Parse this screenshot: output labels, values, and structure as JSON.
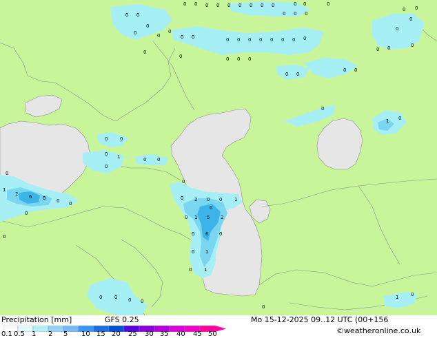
{
  "title": "Precipitation [mm]",
  "model": "GFS 0.25",
  "datetime": "Mo 15-12-2025 09..12 UTC (00+156",
  "credit": "©weatheronline.co.uk",
  "colors": {
    "land": "#c8f59a",
    "sea": "#e6e6e6",
    "precip_light": "#a6f0f5",
    "precip_mid": "#7ad6f0",
    "precip_heavy": "#3cb4e8",
    "border": "#8c8c8c"
  },
  "scale": {
    "ticks": [
      "0.1",
      "0.5",
      "1",
      "2",
      "5",
      "10",
      "15",
      "20",
      "25",
      "30",
      "35",
      "40",
      "45",
      "50"
    ],
    "colors": [
      "#ffffff",
      "#e1fafe",
      "#b4f0fa",
      "#96d2fa",
      "#78b9fa",
      "#3c96f5",
      "#1e6ee6",
      "#0050d2",
      "#5a00dc",
      "#8c00dc",
      "#b400dc",
      "#dc00dc",
      "#f000c8",
      "#ff00a0"
    ]
  },
  "values": [
    "0",
    "0",
    "0",
    "0",
    "0",
    "0",
    "0",
    "0",
    "0",
    "0",
    "0",
    "0",
    "0",
    "0",
    "0",
    "0",
    "0",
    "0",
    "0",
    "0",
    "0",
    "0",
    "0",
    "0",
    "0",
    "0",
    "0",
    "0",
    "0",
    "0",
    "0",
    "0",
    "0",
    "0",
    "0",
    "0",
    "0",
    "0",
    "0",
    "0",
    "0",
    "0",
    "0",
    "0",
    "0",
    "0",
    "0",
    "0",
    "0",
    "0",
    "0",
    "1",
    "0",
    "0",
    "0",
    "1",
    "0",
    "0",
    "0",
    "1",
    "2",
    "6",
    "8",
    "0",
    "0",
    "0",
    "0",
    "0",
    "1",
    "0",
    "0",
    "2",
    "0",
    "0",
    "1",
    "1",
    "5",
    "2",
    "0",
    "6",
    "0",
    "0",
    "1",
    "0",
    "1",
    "0",
    "0",
    "0",
    "0",
    "1",
    "0",
    "0"
  ]
}
